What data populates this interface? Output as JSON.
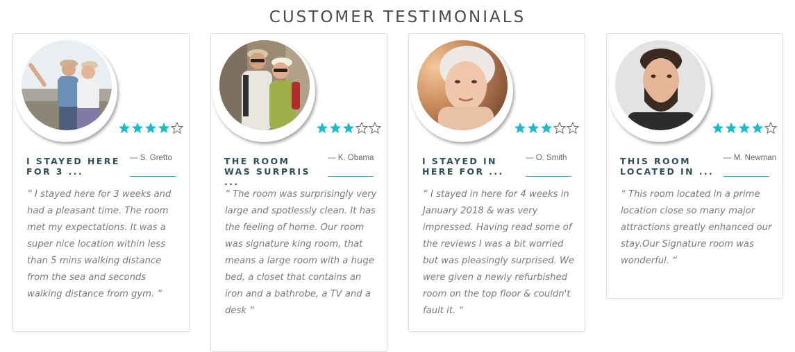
{
  "section": {
    "title": "CUSTOMER TESTIMONIALS"
  },
  "colors": {
    "star_filled": "#1bbbcb",
    "star_empty": "#777777",
    "accent": "#2a9fad"
  },
  "testimonials": [
    {
      "headline": "I STAYED HERE FOR 3 ...",
      "author": "— S. Gretto",
      "rating": 4,
      "rating_max": 5,
      "quote": "“ I stayed here for 3 weeks and had a pleasant time. The room met my expectations. It was a super nice location within less than 5 mins walking distance from the sea and seconds walking distance from gym. “",
      "photo": "couple-selfie-photo"
    },
    {
      "headline": "THE ROOM WAS SURPRIS ...",
      "author": "— K. Obama",
      "rating": 3,
      "rating_max": 5,
      "quote": "“ The room was surprisingly very large and spotlessly clean. It has the feeling of home. Our room was signature king room, that means a large room with a huge bed, a closet that contains an iron and a bathrobe, a TV and a desk “",
      "photo": "couple-travelers-photo"
    },
    {
      "headline": "I STAYED IN HERE FOR ...",
      "author": "— O. Smith",
      "rating": 3,
      "rating_max": 5,
      "quote": "“ I stayed in here for 4 weeks in January 2018 & was very impressed. Having read some of the reviews I was a bit worried but was pleasingly surprised. We were given a newly refurbished room on the top floor & couldn't fault it. “",
      "photo": "elderly-woman-photo"
    },
    {
      "headline": "THIS ROOM LOCATED IN ...",
      "author": "— M. Newman",
      "rating": 4,
      "rating_max": 5,
      "quote": "“ This room located in a prime location close so many major attractions greatly enhanced our stay.Our Signature room was wonderful. “",
      "photo": "bearded-man-photo"
    }
  ]
}
